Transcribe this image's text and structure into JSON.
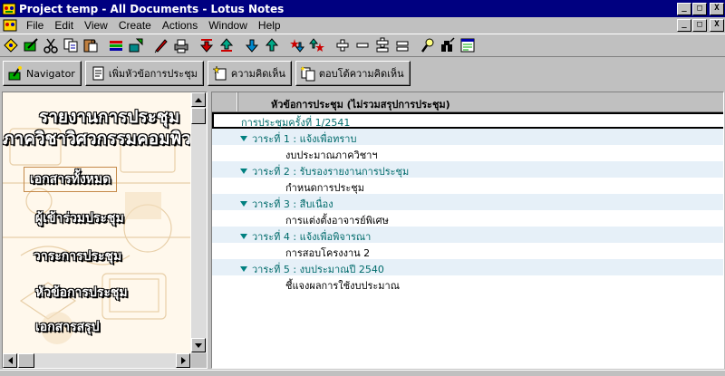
{
  "window": {
    "title": "Project temp - All Documents - Lotus Notes",
    "minimize": "_",
    "restore": "□",
    "close": "X"
  },
  "menu": {
    "items": [
      "File",
      "Edit",
      "View",
      "Create",
      "Actions",
      "Window",
      "Help"
    ],
    "doc_minimize": "_",
    "doc_restore": "□",
    "doc_close": "X"
  },
  "toolbar": {
    "icons": [
      "open-database-icon",
      "edit-document-icon",
      "cut-icon",
      "copy-icon",
      "paste-icon",
      "bookmark-icon",
      "categorize-icon",
      "attachment-icon",
      "print-icon",
      "move-down-icon",
      "move-up-icon",
      "next-unread-icon",
      "previous-unread-icon",
      "next-marked-icon",
      "expand-icon",
      "collapse-icon",
      "expand-all-icon",
      "collapse-all-icon",
      "search-icon",
      "search-bar-icon",
      "properties-icon"
    ]
  },
  "actions": {
    "navigator": "Navigator",
    "new_topic": "เพิ่มหัวข้อการประชุม",
    "comment": "ความคิดเห็น",
    "reply": "ตอบโต้ความคิดเห็น"
  },
  "navigator": {
    "title_line1": "รายงานการประชุม",
    "title_line2": "ภาควิชาวิศวกรรมคอมพิวเตอร์",
    "links": [
      "เอกสารทั้งหมด",
      "ผู้เข้าร่วมประชุม",
      "วาระการประชุม",
      "หัวข้อการประชุม",
      "เอกสารสรุป"
    ],
    "selected_index": 0
  },
  "view": {
    "column_title": "หัวข้อการประชุม (ไม่รวมสรุปการประชุม)",
    "rows": [
      {
        "level": 0,
        "text": "การประชุมครั้งที่ 1/2541"
      },
      {
        "level": 1,
        "text": "วาระที่ 1 : แจ้งเพื่อทราบ"
      },
      {
        "level": 2,
        "text": "งบประมาณภาควิชาฯ"
      },
      {
        "level": 1,
        "text": "วาระที่ 2 : รับรองรายงานการประชุม"
      },
      {
        "level": 2,
        "text": "กำหนดการประชุม"
      },
      {
        "level": 1,
        "text": "วาระที่ 3 : สืบเนื่อง"
      },
      {
        "level": 2,
        "text": "การแต่งตั้งอาจารย์พิเศษ"
      },
      {
        "level": 1,
        "text": "วาระที่ 4 : แจ้งเพื่อพิจารณา"
      },
      {
        "level": 2,
        "text": "การสอบโครงงาน 2"
      },
      {
        "level": 1,
        "text": "วาระที่ 5 : งบประมาณปี 2540"
      },
      {
        "level": 2,
        "text": "ชี้แจงผลการใช้งบประมาณ"
      }
    ]
  },
  "colors": {
    "titlebar": "#000080",
    "category_text": "#006b6b",
    "row_band": "#e6f0f8"
  }
}
